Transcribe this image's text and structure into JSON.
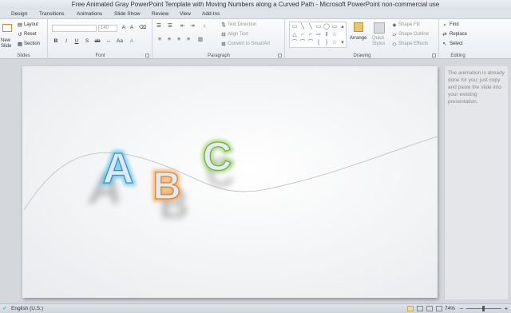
{
  "window": {
    "title": "Free Animated Gray PowerPoint Template with Moving Numbers along a Curved Path  -  Microsoft PowerPoint non-commercial use"
  },
  "tabs": [
    "Design",
    "Transitions",
    "Animations",
    "Slide Show",
    "Review",
    "View",
    "Add-Ins"
  ],
  "ribbon": {
    "slides": {
      "new_slide": "New",
      "new_slide2": "Slide",
      "layout": "Layout",
      "reset": "Reset",
      "section": "Section",
      "label": "Slides"
    },
    "font": {
      "size": "140",
      "label": "Font"
    },
    "paragraph": {
      "text_direction": "Text Direction",
      "align_text": "Align Text",
      "convert_smartart": "Convert to SmartArt",
      "label": "Paragraph"
    },
    "drawing": {
      "arrange": "Arrange",
      "quick_styles": "Quick",
      "quick_styles2": "Styles",
      "shape_fill": "Shape Fill",
      "shape_outline": "Shape Outline",
      "shape_effects": "Shape Effects",
      "label": "Drawing"
    },
    "editing": {
      "find": "Find",
      "replace": "Replace",
      "select": "Select",
      "label": "Editing"
    }
  },
  "slide": {
    "letters": [
      "A",
      "B",
      "C"
    ]
  },
  "notes": {
    "text": "The animation is already done for you; just copy and paste the slide into your existing presentation."
  },
  "status": {
    "language": "English (U.S.)",
    "zoom": "74%"
  }
}
